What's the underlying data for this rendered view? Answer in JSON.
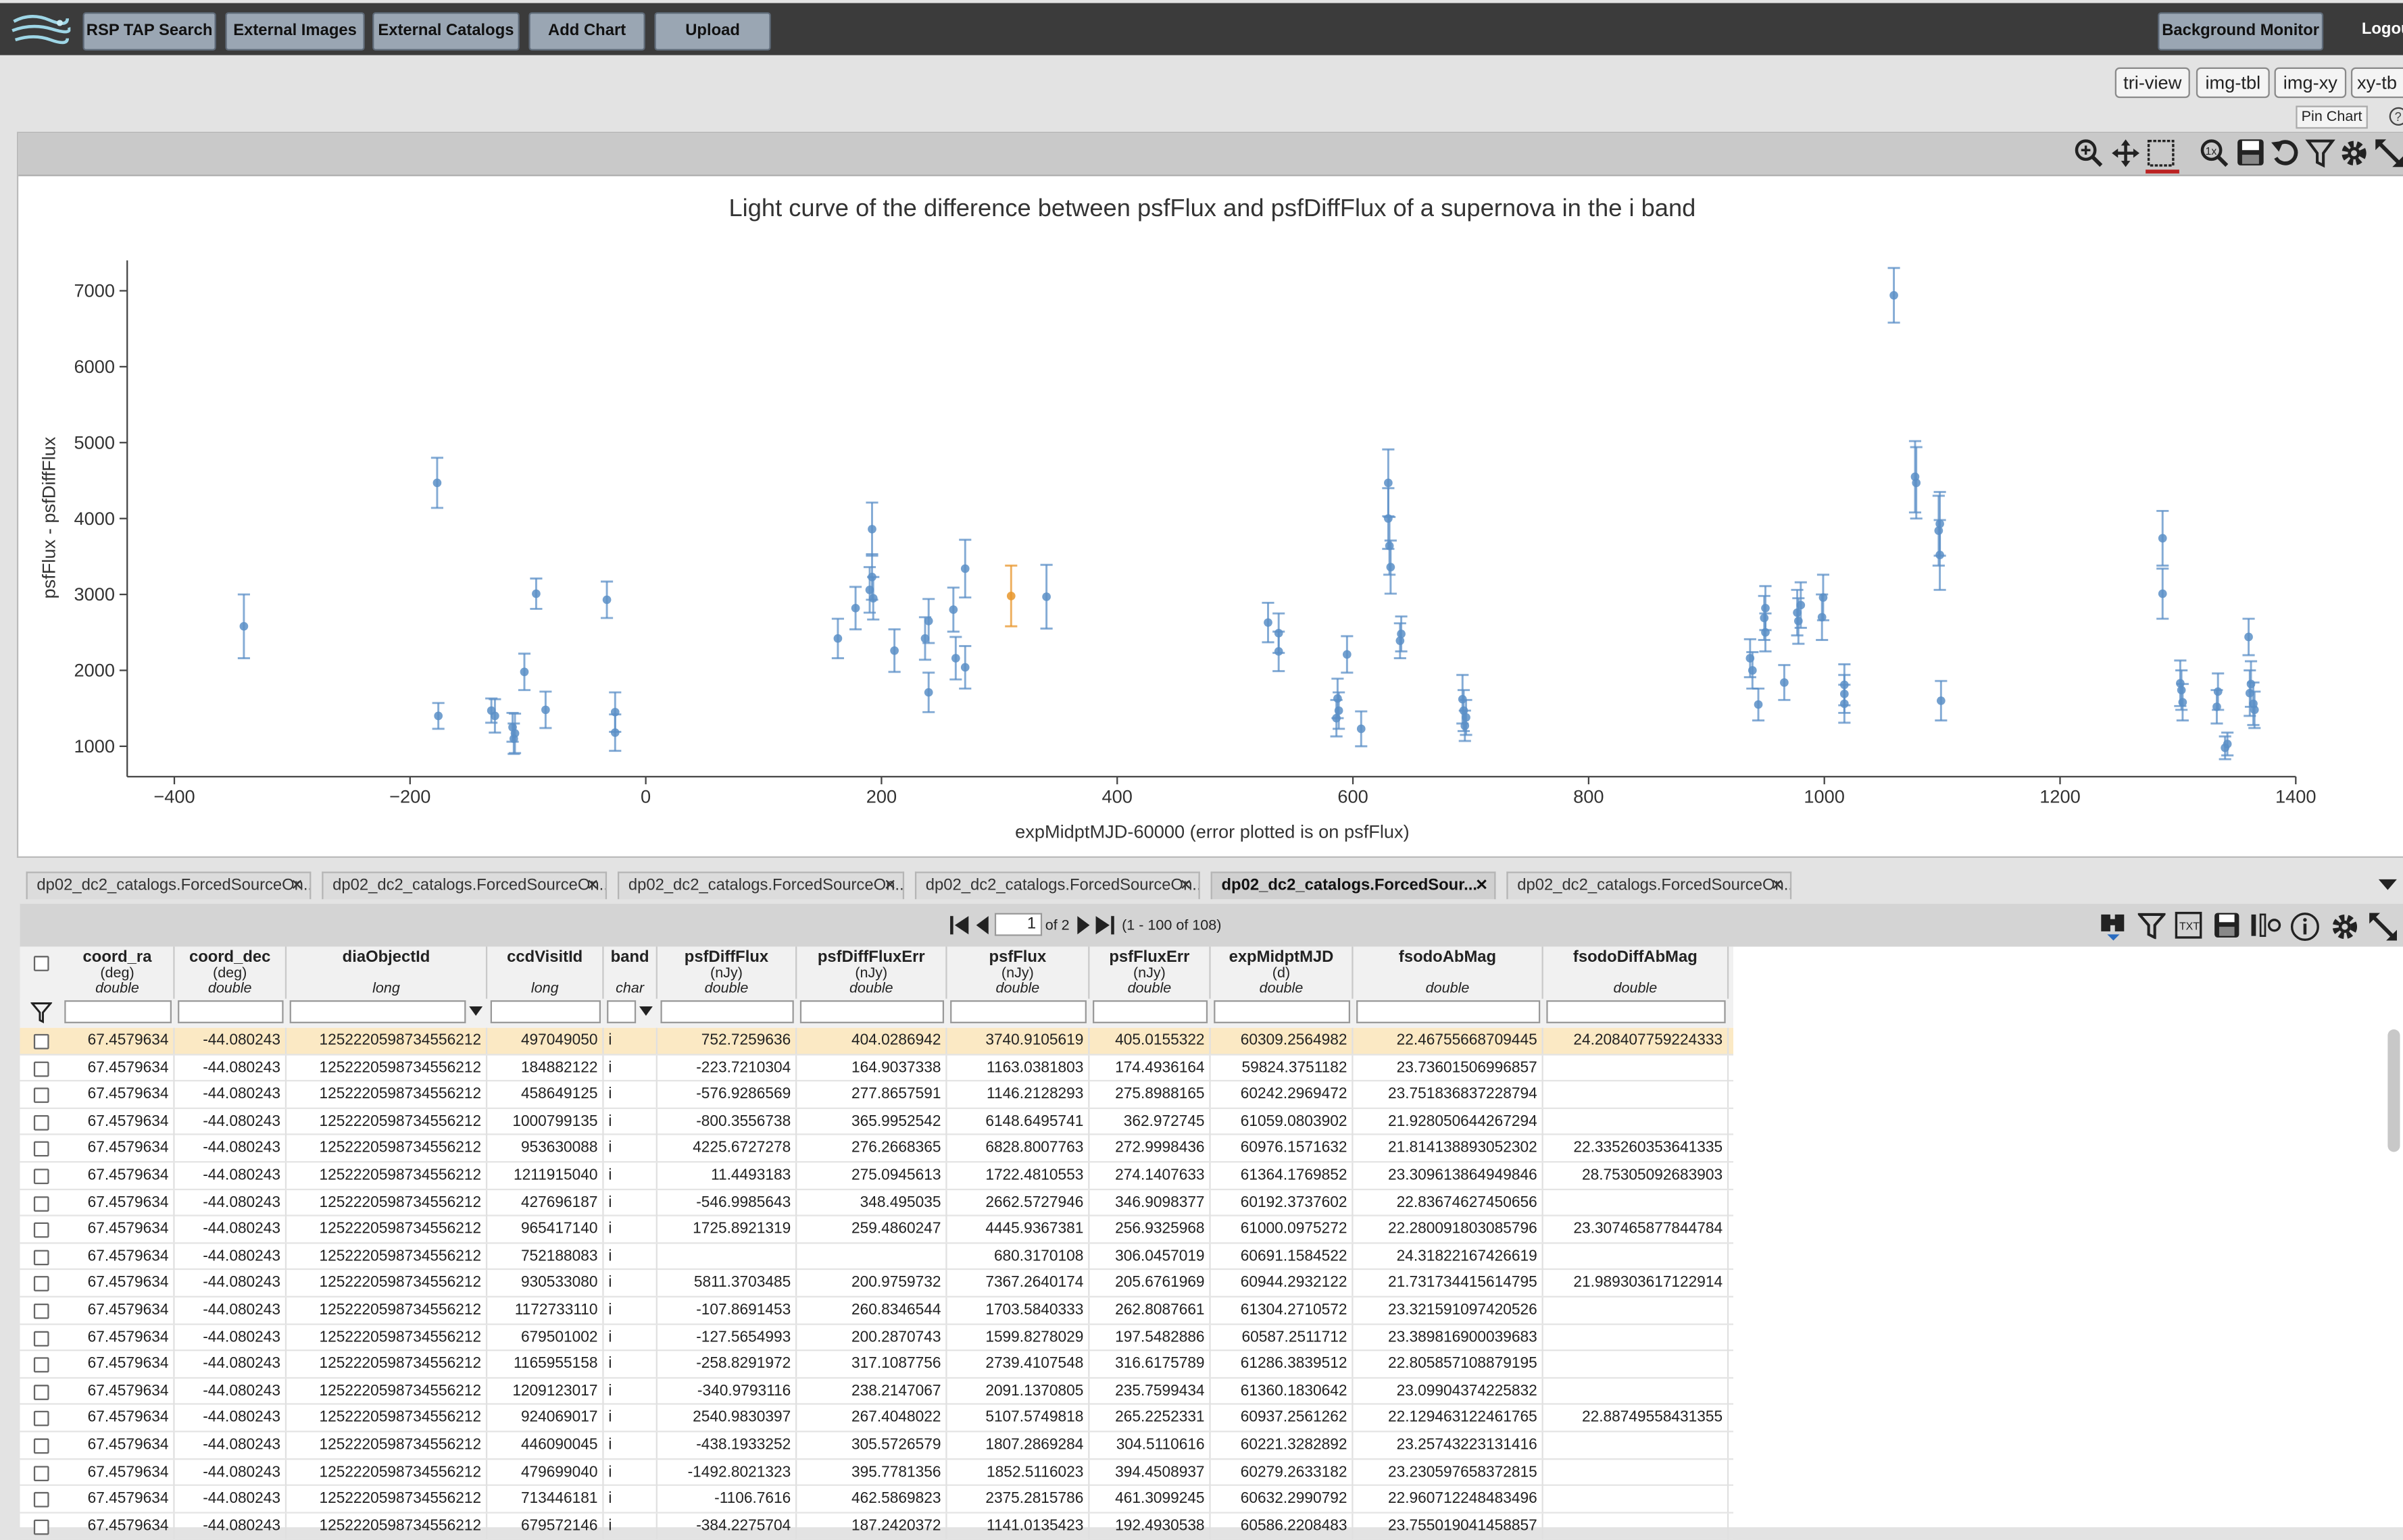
{
  "toolbar": {
    "buttons": [
      "RSP TAP Search",
      "External Images",
      "External Catalogs",
      "Add Chart",
      "Upload"
    ],
    "background_monitor": "Background Monitor",
    "logout": "Logou"
  },
  "view_buttons": [
    "tri-view",
    "img-tbl",
    "img-xy",
    "xy-tb"
  ],
  "pin_chart": "Pin Chart",
  "chart_data": {
    "type": "scatter",
    "title": "Light curve of the difference between psfFlux and psfDiffFlux of a supernova in the i band",
    "xlabel": "expMidptMJD-60000 (error plotted is on psfFlux)",
    "ylabel": "psfFlux - psfDiffFlux",
    "xlim": [
      -440,
      1400
    ],
    "ylim": [
      600,
      7400
    ],
    "xticks": [
      -400,
      -200,
      0,
      200,
      400,
      600,
      800,
      1000,
      1200,
      1400
    ],
    "yticks": [
      1000,
      2000,
      3000,
      4000,
      5000,
      6000,
      7000
    ],
    "grid": false,
    "series": [
      {
        "color": "#5b8fc7",
        "points": [
          [
            -341,
            2580,
            420
          ],
          [
            -177,
            4470,
            330
          ],
          [
            -176,
            1400,
            170
          ],
          [
            -131,
            1470,
            160
          ],
          [
            -128,
            1400,
            220
          ],
          [
            -113,
            1250,
            190
          ],
          [
            -112,
            1100,
            200
          ],
          [
            -111,
            1170,
            260
          ],
          [
            -103,
            1980,
            240
          ],
          [
            -93,
            3010,
            200
          ],
          [
            -85,
            1480,
            240
          ],
          [
            -33,
            2930,
            240
          ],
          [
            -26,
            1450,
            260
          ],
          [
            -26,
            1180,
            240
          ],
          [
            163,
            2420,
            260
          ],
          [
            178,
            2820,
            280
          ],
          [
            190,
            3060,
            300
          ],
          [
            192,
            3860,
            350
          ],
          [
            192,
            3230,
            300
          ],
          [
            193,
            2950,
            280
          ],
          [
            211,
            2260,
            280
          ],
          [
            237,
            2420,
            280
          ],
          [
            240,
            2650,
            290
          ],
          [
            240,
            1710,
            260
          ],
          [
            261,
            2800,
            290
          ],
          [
            263,
            2160,
            280
          ],
          [
            271,
            2040,
            280
          ],
          [
            271,
            3340,
            380
          ],
          [
            340,
            2970,
            420
          ],
          [
            528,
            2630,
            260
          ],
          [
            537,
            2490,
            260
          ],
          [
            537,
            2250,
            260
          ],
          [
            586,
            1370,
            240
          ],
          [
            587,
            1630,
            260
          ],
          [
            588,
            1470,
            240
          ],
          [
            595,
            2210,
            240
          ],
          [
            607,
            1230,
            230
          ],
          [
            630,
            4470,
            440
          ],
          [
            630,
            4000,
            400
          ],
          [
            631,
            3640,
            380
          ],
          [
            632,
            3360,
            350
          ],
          [
            640,
            2390,
            230
          ],
          [
            641,
            2480,
            230
          ],
          [
            693,
            1620,
            320
          ],
          [
            694,
            1470,
            270
          ],
          [
            695,
            1270,
            200
          ],
          [
            696,
            1380,
            230
          ],
          [
            937,
            2160,
            250
          ],
          [
            939,
            2000,
            240
          ],
          [
            944,
            1550,
            210
          ],
          [
            949,
            2690,
            290
          ],
          [
            950,
            2500,
            250
          ],
          [
            950,
            2820,
            290
          ],
          [
            966,
            1840,
            230
          ],
          [
            977,
            2760,
            300
          ],
          [
            978,
            2650,
            300
          ],
          [
            980,
            2860,
            300
          ],
          [
            998,
            2700,
            300
          ],
          [
            999,
            2960,
            300
          ],
          [
            1017,
            1810,
            270
          ],
          [
            1017,
            1560,
            250
          ],
          [
            1017,
            1690,
            250
          ],
          [
            1059,
            6940,
            360
          ],
          [
            1077,
            4550,
            470
          ],
          [
            1078,
            4470,
            470
          ],
          [
            1097,
            3840,
            460
          ],
          [
            1098,
            3520,
            460
          ],
          [
            1098,
            3930,
            420
          ],
          [
            1099,
            1600,
            260
          ],
          [
            1287,
            3740,
            360
          ],
          [
            1287,
            3010,
            330
          ],
          [
            1302,
            1830,
            300
          ],
          [
            1303,
            1740,
            260
          ],
          [
            1304,
            1580,
            240
          ],
          [
            1333,
            1520,
            220
          ],
          [
            1334,
            1720,
            240
          ],
          [
            1340,
            980,
            150
          ],
          [
            1342,
            1030,
            150
          ],
          [
            1360,
            2440,
            240
          ],
          [
            1361,
            1700,
            300
          ],
          [
            1362,
            1820,
            300
          ],
          [
            1364,
            1560,
            280
          ],
          [
            1365,
            1480,
            240
          ]
        ]
      },
      {
        "color": "#e8962b",
        "points": [
          [
            310,
            2980,
            400
          ]
        ]
      }
    ]
  },
  "tabs": [
    "dp02_dc2_catalogs.ForcedSourceOn...",
    "dp02_dc2_catalogs.ForcedSourceOn...",
    "dp02_dc2_catalogs.ForcedSourceOn...",
    "dp02_dc2_catalogs.ForcedSourceOn...",
    "dp02_dc2_catalogs.ForcedSour...",
    "dp02_dc2_catalogs.ForcedSourceOn..."
  ],
  "pager": {
    "page": "1",
    "of": "of 2",
    "range": "(1 - 100 of 108)"
  },
  "table": {
    "columns": [
      {
        "name": "coord_ra",
        "unit": "(deg)",
        "type": "double"
      },
      {
        "name": "coord_dec",
        "unit": "(deg)",
        "type": "double"
      },
      {
        "name": "diaObjectId",
        "unit": "",
        "type": "long"
      },
      {
        "name": "ccdVisitId",
        "unit": "",
        "type": "long"
      },
      {
        "name": "band",
        "unit": "",
        "type": "char"
      },
      {
        "name": "psfDiffFlux",
        "unit": "(nJy)",
        "type": "double"
      },
      {
        "name": "psfDiffFluxErr",
        "unit": "(nJy)",
        "type": "double"
      },
      {
        "name": "psfFlux",
        "unit": "(nJy)",
        "type": "double"
      },
      {
        "name": "psfFluxErr",
        "unit": "(nJy)",
        "type": "double"
      },
      {
        "name": "expMidptMJD",
        "unit": "(d)",
        "type": "double"
      },
      {
        "name": "fsodoAbMag",
        "unit": "",
        "type": "double"
      },
      {
        "name": "fsodoDiffAbMag",
        "unit": "",
        "type": "double"
      }
    ],
    "rows": [
      [
        "67.4579634",
        "-44.080243",
        "1252220598734556212",
        "497049050",
        "i",
        "752.7259636",
        "404.0286942",
        "3740.9105619",
        "405.0155322",
        "60309.2564982",
        "22.46755668709445",
        "24.208407759224333"
      ],
      [
        "67.4579634",
        "-44.080243",
        "1252220598734556212",
        "184882122",
        "i",
        "-223.7210304",
        "164.9037338",
        "1163.0381803",
        "174.4936164",
        "59824.3751182",
        "23.73601506996857",
        ""
      ],
      [
        "67.4579634",
        "-44.080243",
        "1252220598734556212",
        "458649125",
        "i",
        "-576.9286569",
        "277.8657591",
        "1146.2128293",
        "275.8988165",
        "60242.2969472",
        "23.751836837228794",
        ""
      ],
      [
        "67.4579634",
        "-44.080243",
        "1252220598734556212",
        "1000799135",
        "i",
        "-800.3556738",
        "365.9952542",
        "6148.6495741",
        "362.972745",
        "61059.0803902",
        "21.928050644267294",
        ""
      ],
      [
        "67.4579634",
        "-44.080243",
        "1252220598734556212",
        "953630088",
        "i",
        "4225.6727278",
        "276.2668365",
        "6828.8007763",
        "272.9998436",
        "60976.1571632",
        "21.814138893052302",
        "22.335260353641335"
      ],
      [
        "67.4579634",
        "-44.080243",
        "1252220598734556212",
        "1211915040",
        "i",
        "11.4493183",
        "275.0945613",
        "1722.4810553",
        "274.1407633",
        "61364.1769852",
        "23.309613864949846",
        "28.75305092683903"
      ],
      [
        "67.4579634",
        "-44.080243",
        "1252220598734556212",
        "427696187",
        "i",
        "-546.9985643",
        "348.495035",
        "2662.5727946",
        "346.9098377",
        "60192.3737602",
        "22.83674627450656",
        ""
      ],
      [
        "67.4579634",
        "-44.080243",
        "1252220598734556212",
        "965417140",
        "i",
        "1725.8921319",
        "259.4860247",
        "4445.9367381",
        "256.9325968",
        "61000.0975272",
        "22.280091803085796",
        "23.307465877844784"
      ],
      [
        "67.4579634",
        "-44.080243",
        "1252220598734556212",
        "752188083",
        "i",
        "",
        "",
        "680.3170108",
        "306.0457019",
        "60691.1584522",
        "24.31822167426619",
        ""
      ],
      [
        "67.4579634",
        "-44.080243",
        "1252220598734556212",
        "930533080",
        "i",
        "5811.3703485",
        "200.9759732",
        "7367.2640174",
        "205.6761969",
        "60944.2932122",
        "21.731734415614795",
        "21.989303617122914"
      ],
      [
        "67.4579634",
        "-44.080243",
        "1252220598734556212",
        "1172733110",
        "i",
        "-107.8691453",
        "260.8346544",
        "1703.5840333",
        "262.8087661",
        "61304.2710572",
        "23.321591097420526",
        ""
      ],
      [
        "67.4579634",
        "-44.080243",
        "1252220598734556212",
        "679501002",
        "i",
        "-127.5654993",
        "200.2870743",
        "1599.8278029",
        "197.5482886",
        "60587.2511712",
        "23.389816900039683",
        ""
      ],
      [
        "67.4579634",
        "-44.080243",
        "1252220598734556212",
        "1165955158",
        "i",
        "-258.8291972",
        "317.1087756",
        "2739.4107548",
        "316.6175789",
        "61286.3839512",
        "22.805857108879195",
        ""
      ],
      [
        "67.4579634",
        "-44.080243",
        "1252220598734556212",
        "1209123017",
        "i",
        "-340.9793116",
        "238.2147067",
        "2091.1370805",
        "235.7599434",
        "61360.1830642",
        "23.09904374225832",
        ""
      ],
      [
        "67.4579634",
        "-44.080243",
        "1252220598734556212",
        "924069017",
        "i",
        "2540.9830397",
        "267.4048022",
        "5107.5749818",
        "265.2252331",
        "60937.2561262",
        "22.129463122461765",
        "22.88749558431355"
      ],
      [
        "67.4579634",
        "-44.080243",
        "1252220598734556212",
        "446090045",
        "i",
        "-438.1933252",
        "305.5726579",
        "1807.2869284",
        "304.5110616",
        "60221.3282892",
        "23.25743223131416",
        ""
      ],
      [
        "67.4579634",
        "-44.080243",
        "1252220598734556212",
        "479699040",
        "i",
        "-1492.8021323",
        "395.7781356",
        "1852.5116023",
        "394.4508937",
        "60279.2633182",
        "23.230597658372815",
        ""
      ],
      [
        "67.4579634",
        "-44.080243",
        "1252220598734556212",
        "713446181",
        "i",
        "-1106.7616",
        "462.5869823",
        "2375.2815786",
        "461.3099245",
        "60632.2990792",
        "22.960712248483496",
        ""
      ],
      [
        "67.4579634",
        "-44.080243",
        "1252220598734556212",
        "679572146",
        "i",
        "-384.2275704",
        "187.2420372",
        "1141.0135423",
        "192.4930538",
        "60586.2208483",
        "23.755019041458857",
        ""
      ]
    ]
  }
}
